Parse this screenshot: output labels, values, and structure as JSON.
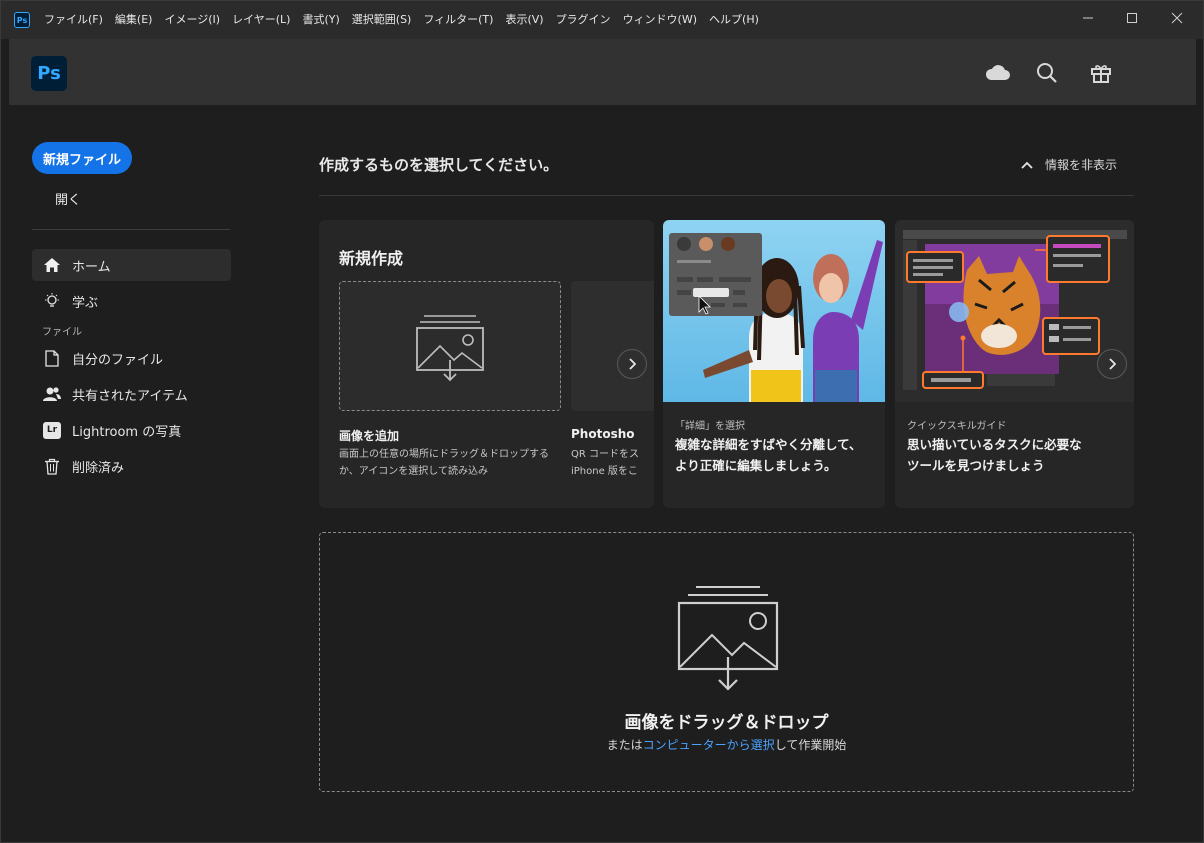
{
  "menu": [
    "ファイル(F)",
    "編集(E)",
    "イメージ(I)",
    "レイヤー(L)",
    "書式(Y)",
    "選択範囲(S)",
    "フィルター(T)",
    "表示(V)",
    "プラグイン",
    "ウィンドウ(W)",
    "ヘルプ(H)"
  ],
  "app": {
    "badge": "Ps",
    "logo": "Ps"
  },
  "sidebar": {
    "new_file": "新規ファイル",
    "open": "開く",
    "home": "ホーム",
    "learn": "学ぶ",
    "section_files": "ファイル",
    "my_files": "自分のファイル",
    "shared": "共有されたアイテム",
    "lightroom": "Lightroom の写真",
    "lightroom_badge": "Lr",
    "deleted": "削除済み"
  },
  "main": {
    "title": "作成するものを選択してください。",
    "hide_info": "情報を非表示"
  },
  "new_card": {
    "title": "新規作成",
    "add_title": "画像を追加",
    "add_desc_1": "画面上の任意の場所にドラッグ＆ドロップする",
    "add_desc_2": "か、アイコンを選択して読み込み",
    "peek_title": "Photosho",
    "peek_desc_1": "QR コードをス",
    "peek_desc_2": "iPhone 版をこ"
  },
  "cards": [
    {
      "kicker": "「詳細」を選択",
      "line1": "複雑な詳細をすばやく分離して、",
      "line2": "より正確に編集しましょう。"
    },
    {
      "kicker": "クイックスキルガイド",
      "line1": "思い描いているタスクに必要な",
      "line2": "ツールを見つけましょう"
    }
  ],
  "dropzone": {
    "title": "画像をドラッグ＆ドロップ",
    "sub_prefix": "または",
    "sub_link": "コンピューターから選択",
    "sub_suffix": "して作業開始"
  },
  "colors": {
    "accent": "#1473e6",
    "link": "#4aa3ff",
    "ps_blue": "#31a8ff",
    "ps_bg": "#001e36"
  }
}
